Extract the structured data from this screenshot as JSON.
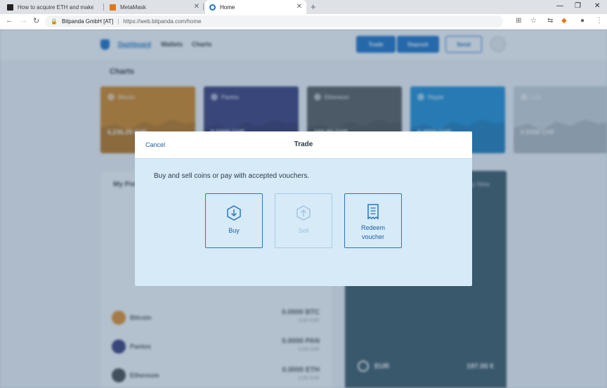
{
  "browser": {
    "tabs": [
      {
        "title": "How to acquire ETH and make a",
        "favicon": "medium-icon",
        "active": false
      },
      {
        "title": "MetaMask",
        "favicon": "metamask-fox-icon",
        "active": false
      },
      {
        "title": "Home",
        "favicon": "bitpanda-icon",
        "active": true
      }
    ],
    "site_identity": "Bitpanda GmbH [AT]",
    "url": "https://web.bitpanda.com/home"
  },
  "app": {
    "nav": {
      "dashboard": "Dashboard",
      "wallets": "Wallets",
      "charts": "Charts"
    },
    "buttons": {
      "trade": "Trade",
      "deposit": "Deposit",
      "send": "Send"
    },
    "charts_title": "Charts",
    "cards": [
      {
        "name": "Bitcoin",
        "price": "6,236.29 CHF",
        "color": "#d9861c"
      },
      {
        "name": "Pantos",
        "price": "0.0208 CHF",
        "color": "#3b3b78"
      },
      {
        "name": "Ethereum",
        "price": "166.90 CHF",
        "color": "#5a5a5a"
      },
      {
        "name": "Ripple",
        "price": "0.4820 CHF",
        "color": "#1e8fd6"
      },
      {
        "name": "Lisk",
        "price": "0.9398 CHF",
        "color": "#cfd6dc"
      }
    ],
    "portfolio": {
      "title": "My Portfolio",
      "coins": [
        {
          "name": "Bitcoin",
          "amount": "0.0000 BTC",
          "fiat": "0.00 CHF",
          "color": "#e8912a"
        },
        {
          "name": "Pantos",
          "amount": "0.0000 PAN",
          "fiat": "0.00 CHF",
          "color": "#3b3b78"
        },
        {
          "name": "Ethereum",
          "amount": "0.0000 ETH",
          "fiat": "0.00 CHF",
          "color": "#4a4a4a"
        }
      ]
    },
    "right_panel": {
      "title": "Buy Now",
      "eur_label": "EUR",
      "eur_amount": "197.00 €"
    }
  },
  "modal": {
    "cancel": "Cancel",
    "title": "Trade",
    "description": "Buy and sell coins or pay with accepted vouchers.",
    "options": {
      "buy": "Buy",
      "sell": "Sell",
      "redeem": "Redeem voucher"
    },
    "accent_color": "#2976c4"
  }
}
